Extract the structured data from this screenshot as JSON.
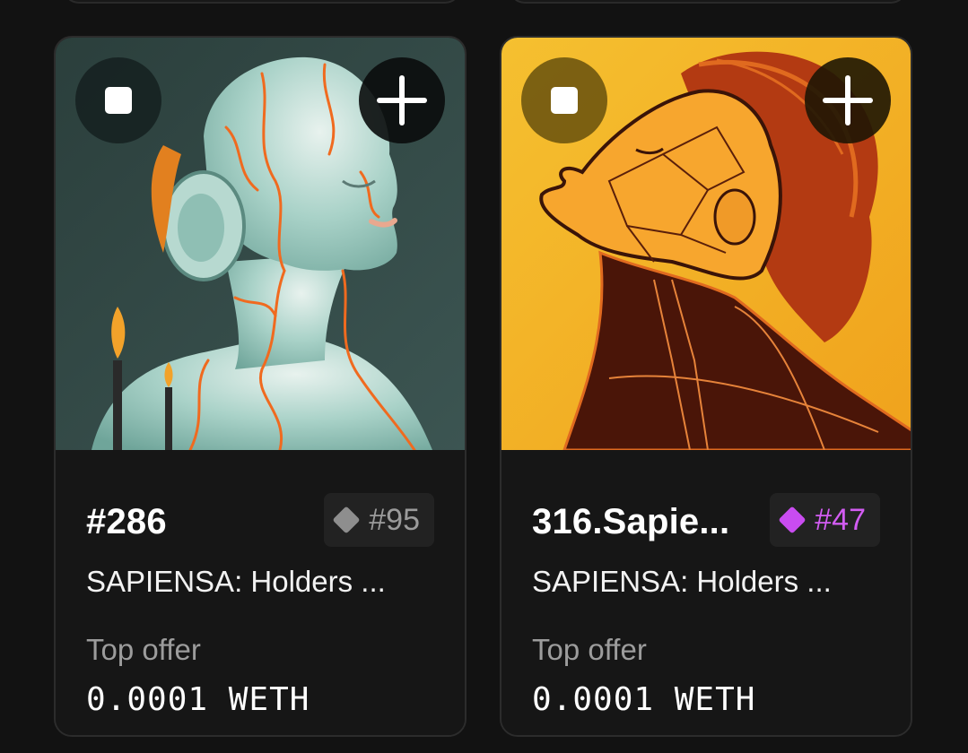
{
  "cards": [
    {
      "title": "#286",
      "rank": "#95",
      "rank_color": "#9b9b9b",
      "collection": "SAPIENSA: Holders ...",
      "offer_label": "Top offer",
      "offer_value": "0.0001  WETH",
      "image_bg": "#2f4744"
    },
    {
      "title": "316.Sapie...",
      "rank": "#47",
      "rank_color": "#d25cf2",
      "collection": "SAPIENSA: Holders ...",
      "offer_label": "Top offer",
      "offer_value": "0.0001  WETH",
      "image_bg": "#f3b021"
    }
  ],
  "icons": {
    "select": "checkbox-square-icon",
    "add": "plus-icon",
    "rarity": "diamond-icon"
  }
}
